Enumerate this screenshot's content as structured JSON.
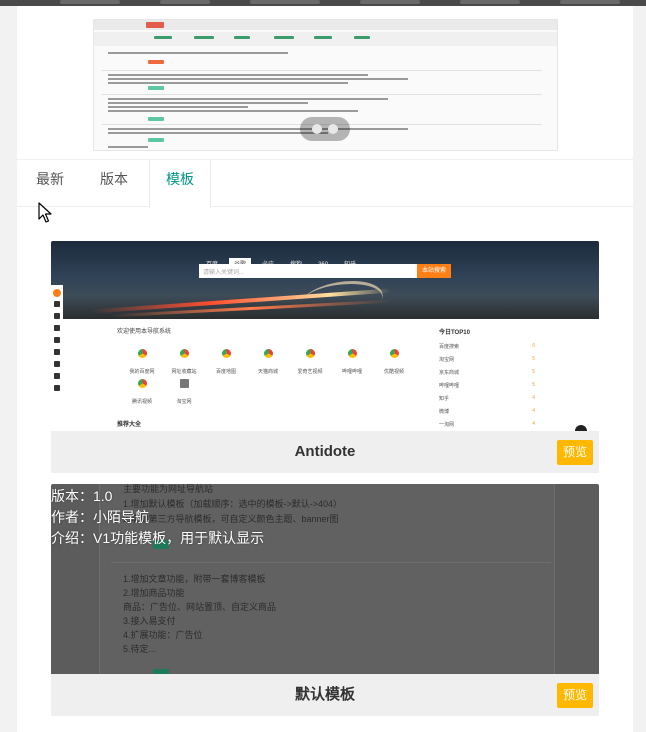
{
  "tabs": [
    {
      "label": "最新"
    },
    {
      "label": "版本"
    },
    {
      "label": "模板",
      "active": true
    }
  ],
  "templates": [
    {
      "name": "Antidote",
      "preview_label": "预览",
      "screenshot": {
        "hero_tabs": [
          "百度",
          "谷歌",
          "必应",
          "搜狗",
          "360",
          "知乎"
        ],
        "search_placeholder": "请输入关键词...",
        "search_button": "本站搜索",
        "marquee": "欢迎使用本导航系统",
        "top_title": "今日TOP10",
        "sites": [
          "我的百度网",
          "网址收藏站",
          "百度地图",
          "天猫商城",
          "爱奇艺视频",
          "哔哩哔哩",
          "优酷视频",
          "腾讯视频",
          "淘宝网"
        ],
        "section_title": "推荐大全",
        "top_rows": [
          "百度搜索",
          "淘宝网",
          "京东商城",
          "哔哩哔哩",
          "知乎",
          "微博",
          "一淘网"
        ],
        "top_counts": [
          "6",
          "5",
          "5",
          "5",
          "4",
          "4",
          "4"
        ]
      }
    },
    {
      "name": "默认模板",
      "preview_label": "预览",
      "screenshot": {
        "lines": [
          "主要功能为网址导航站",
          "1.增加默认模板（加载顺序：选中的模板->默认->404）",
          "2.增加第三方导航模板，可自定义颜色主题、banner图",
          "1.增加文章功能，附带一套博客模板",
          "2.增加商品功能",
          "商品：广告位、网站置顶、自定义商品",
          "3.接入易支付",
          "4.扩展功能：广告位",
          "5.待定..."
        ],
        "version": "版本：1.0",
        "author": "作者：小陌导航",
        "intro": "介绍：V1功能模板，用于默认显示"
      }
    }
  ],
  "colors": {
    "accent": "#009688",
    "preview_button": "#ffb800"
  }
}
